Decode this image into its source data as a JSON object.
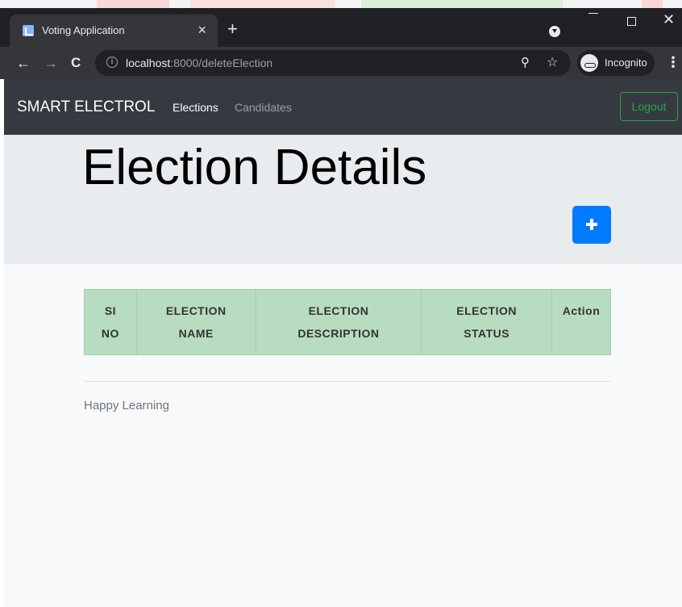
{
  "browser": {
    "tab_title": "Voting Application",
    "tab_close": "×",
    "new_tab": "+",
    "url_host": "localhost",
    "url_rest": ":8000/deleteElection",
    "profile_label": "Incognito",
    "back": "←",
    "forward": "→",
    "reload": "C",
    "zoom": "⚲",
    "star": "☆",
    "menu": "⋮",
    "info": "i",
    "close_window": "✕"
  },
  "navbar": {
    "brand": "SMART ELECTROL",
    "links": [
      "Elections",
      "Candidates"
    ],
    "logout": "Logout"
  },
  "jumbotron": {
    "title": "Election Details"
  },
  "table": {
    "headers": [
      {
        "line1": "SI",
        "line2": "NO"
      },
      {
        "line1": "ELECTION",
        "line2": "NAME"
      },
      {
        "line1": "ELECTION",
        "line2": "DESCRIPTION"
      },
      {
        "line1": "ELECTION",
        "line2": "STATUS"
      },
      {
        "line1": "Action",
        "line2": ""
      }
    ]
  },
  "footer": {
    "text": "Happy Learning"
  },
  "colors": {
    "navbar_bg": "#343a40",
    "jumbotron_bg": "#e9ecef",
    "primary": "#007bff",
    "success": "#28a745",
    "table_header_bg": "#b8dcbf"
  }
}
